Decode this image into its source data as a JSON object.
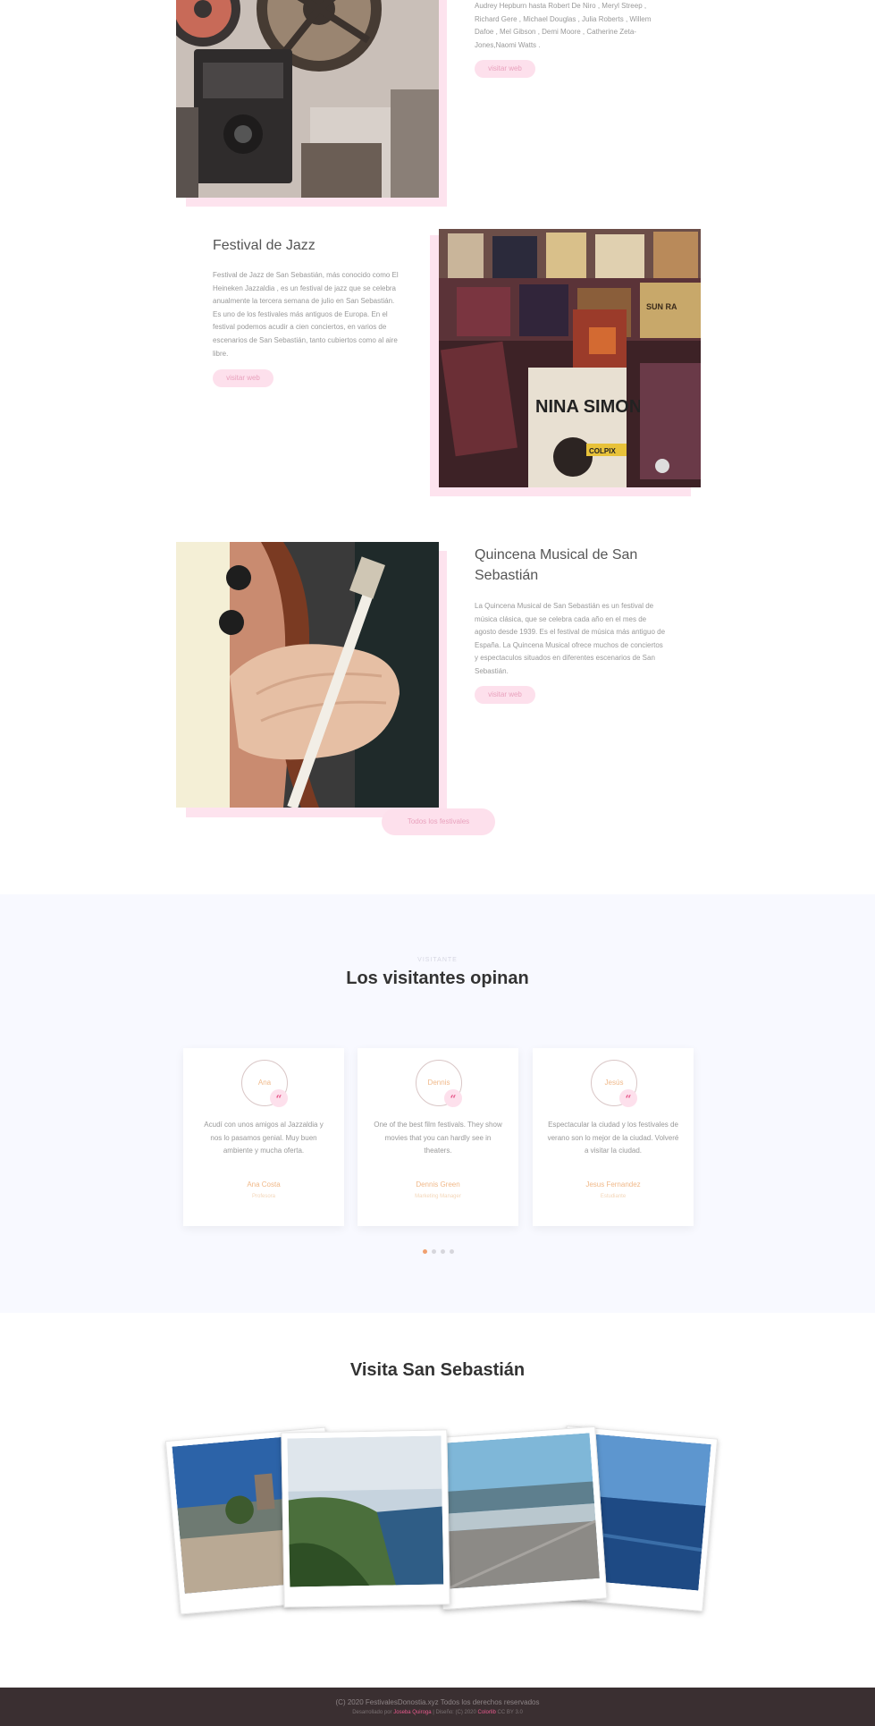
{
  "festivals": [
    {
      "desc": "Audrey Hepburn hasta Robert De Niro , Meryl Streep , Richard Gere , Michael Douglas , Julia Roberts , Willem Dafoe , Mel Gibson , Demi Moore , Catherine Zeta-Jones,Naomi Watts .",
      "button": "visitar web"
    },
    {
      "title": "Festival de Jazz",
      "desc": "Festival de Jazz de San Sebastián, más conocido como El Heineken Jazzaldia , es un festival de jazz que se celebra anualmente la tercera semana de julio en San Sebastián. Es uno de los festivales más antiguos de Europa. En el festival podemos acudir a cien conciertos, en varios de escenarios de San Sebastián, tanto cubiertos como al aire libre.",
      "button": "visitar web",
      "record_labels": [
        "NINA SIMONE",
        "SUN RA",
        "COLPIX"
      ]
    },
    {
      "title": "Quincena Musical de San Sebastián",
      "desc": "La Quincena Musical de San Sebastián es un festival de música clásica, que se celebra cada año en el mes de agosto desde 1939. Es el festival de música más antiguo de España. La Quincena Musical ofrece muchos de conciertos y espectaculos situados en diferentes escenarios de San Sebastián.",
      "button": "visitar web"
    }
  ],
  "all_festivals_button": "Todos los festivales",
  "visitors": {
    "eyebrow": "VISITANTE",
    "title": "Los visitantes opinan",
    "cards": [
      {
        "avatar": "Ana",
        "text": "Acudí con unos amigos al Jazzaldia y nos lo pasamos genial. Muy buen ambiente y mucha oferta.",
        "name": "Ana Costa",
        "role": "Profesora"
      },
      {
        "avatar": "Dennis",
        "text": "One of the best film festivals. They show movies that you can hardly see in theaters.",
        "name": "Dennis Green",
        "role": "Marketing Manager"
      },
      {
        "avatar": "Jesús",
        "text": "Espectacular la ciudad y los festivales de verano son lo mejor de la ciudad. Volveré a visitar la ciudad.",
        "name": "Jesus Fernandez",
        "role": "Estudiante"
      }
    ],
    "quote_mark": "“"
  },
  "gallery": {
    "title": "Visita San Sebastián"
  },
  "footer": {
    "line1": "(C) 2020 FestivalesDonostia.xyz Todos los derechos reservados",
    "line2_pre": "Desarrollado por ",
    "developer": "Joseba Quiroga",
    "line2_mid": " | Diseño: (C) 2020 ",
    "designer": "Colorlib",
    "line2_post": " CC BY 3.0"
  },
  "colors": {
    "accent_pink": "#e75a8d",
    "pill_bg": "#fde0ec",
    "accent_orange": "#f0b98a",
    "section_bg": "#f8f9ff",
    "footer_bg": "#3a2f31"
  },
  "icons": [
    "quote-icon"
  ]
}
